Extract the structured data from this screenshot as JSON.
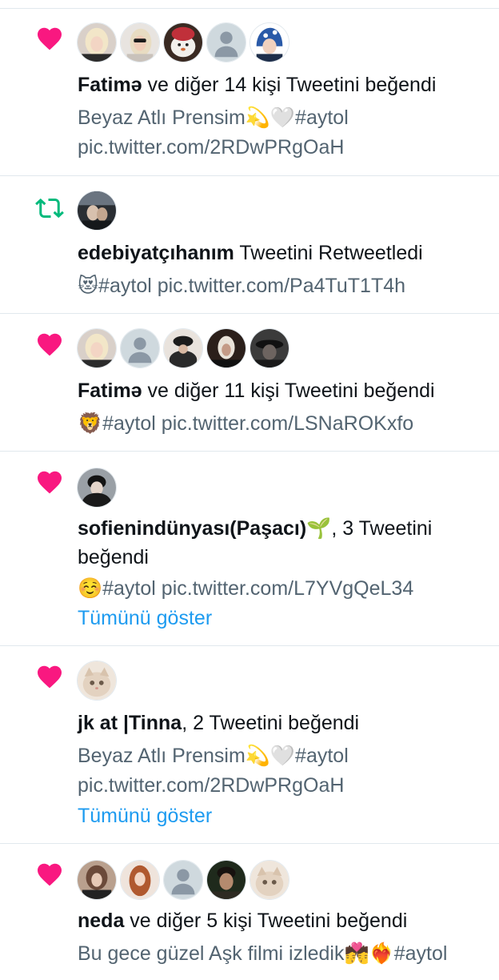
{
  "activity": [
    {
      "type": "like",
      "avatars": [
        "avatar-blonde-woman",
        "avatar-woman-sunglasses",
        "avatar-teddy-bear",
        "avatar-default",
        "avatar-child-scarf"
      ],
      "actor": "Fatimə",
      "action": " ve diğer 14 kişi Tweetini beğendi",
      "text_line1": "Beyaz Atlı Prensim💫🤍#aytol",
      "text_line2": "pic.twitter.com/2RDwPRgOaH"
    },
    {
      "type": "retweet",
      "avatars": [
        "avatar-couple-photo"
      ],
      "actor": "edebiyatçıhanım",
      "action": " Tweetini Retweetledi",
      "text_line1": "😻#aytol pic.twitter.com/Pa4TuT1T4h"
    },
    {
      "type": "like",
      "avatars": [
        "avatar-blonde-woman",
        "avatar-default",
        "avatar-dark-cap",
        "avatar-dark-portrait",
        "avatar-dark-hat"
      ],
      "actor": "Fatimə",
      "action": " ve diğer 11 kişi Tweetini beğendi",
      "text_line1": "🦁#aytol pic.twitter.com/LSNaROKxfo"
    },
    {
      "type": "like",
      "avatars": [
        "avatar-man-dark"
      ],
      "actor": "sofienindünyası(Paşacı)🌱",
      "action": ", 3 Tweetini",
      "action_line2": "beğendi",
      "text_line1": "☺️#aytol pic.twitter.com/L7YVgQeL34",
      "show_all": "Tümünü göster"
    },
    {
      "type": "like",
      "avatars": [
        "avatar-cat"
      ],
      "actor": "jk at |Tinna",
      "action": ", 2 Tweetini beğendi",
      "text_line1": "Beyaz Atlı Prensim💫🤍#aytol",
      "text_line2": "pic.twitter.com/2RDwPRgOaH",
      "show_all": "Tümünü göster"
    },
    {
      "type": "like",
      "avatars": [
        "avatar-woman-dark",
        "avatar-redhead",
        "avatar-default",
        "avatar-man-portrait",
        "avatar-cat"
      ],
      "actor": "neda",
      "action": " ve diğer 5 kişi Tweetini beğendi",
      "text_line1": "Bu gece güzel Aşk filmi izledik💏❤️‍🔥#aytol"
    }
  ],
  "colors": {
    "like": "#f91880",
    "retweet": "#00ba7c",
    "link": "#1d9bf0",
    "muted": "#536471",
    "divider": "#e1e8ed"
  }
}
